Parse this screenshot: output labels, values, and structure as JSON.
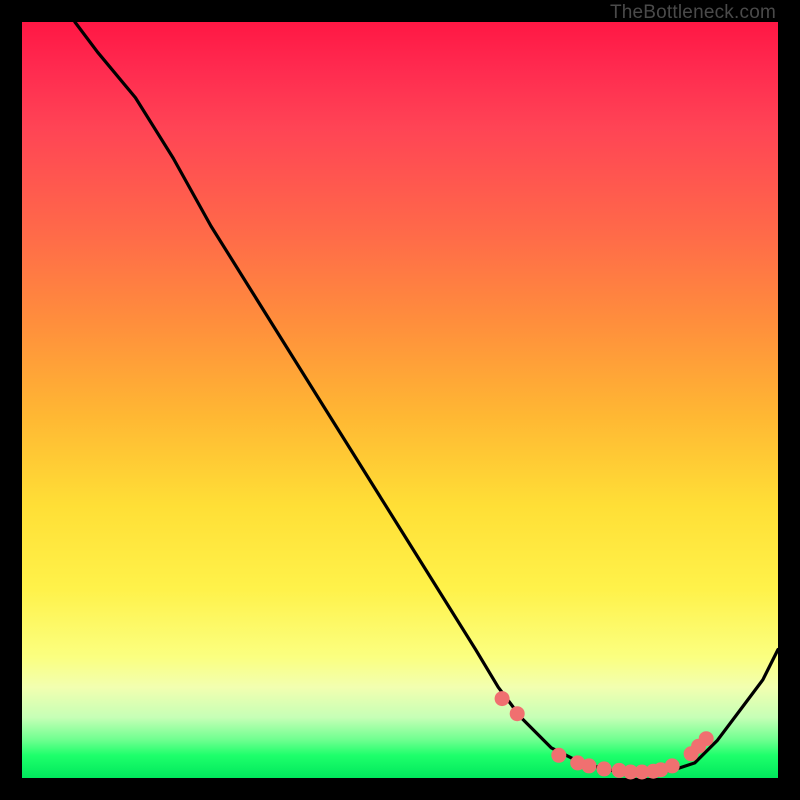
{
  "attribution": "TheBottleneck.com",
  "colors": {
    "frame": "#000000",
    "curve": "#000000",
    "dots": "#f07070",
    "gradient_stops": [
      "#ff1744",
      "#ff4455",
      "#ff8f3c",
      "#ffdf36",
      "#fbff80",
      "#1eff6b",
      "#00e85c"
    ]
  },
  "chart_data": {
    "type": "line",
    "title": "",
    "xlabel": "",
    "ylabel": "",
    "xlim": [
      0,
      100
    ],
    "ylim": [
      0,
      100
    ],
    "note": "No axis ticks or labels are shown; values are estimated from pixel positions on a 0–100 normalized scale (y increases upward).",
    "series": [
      {
        "name": "bottleneck-curve",
        "x": [
          7,
          10,
          15,
          20,
          25,
          30,
          35,
          40,
          45,
          50,
          55,
          60,
          63,
          66,
          70,
          74,
          78,
          82,
          86,
          89,
          92,
          95,
          98,
          100
        ],
        "y": [
          100,
          96,
          90,
          82,
          73,
          65,
          57,
          49,
          41,
          33,
          25,
          17,
          12,
          8,
          4,
          2,
          1,
          0.7,
          1,
          2,
          5,
          9,
          13,
          17
        ]
      }
    ],
    "markers": {
      "name": "highlight-dots",
      "x": [
        63.5,
        65.5,
        71,
        73.5,
        75,
        77,
        79,
        80.5,
        82,
        83.5,
        84.5,
        86,
        88.5,
        89.5,
        90.5
      ],
      "y": [
        10.5,
        8.5,
        3.0,
        2.0,
        1.6,
        1.2,
        1.0,
        0.8,
        0.8,
        0.9,
        1.1,
        1.6,
        3.2,
        4.2,
        5.2
      ]
    }
  }
}
